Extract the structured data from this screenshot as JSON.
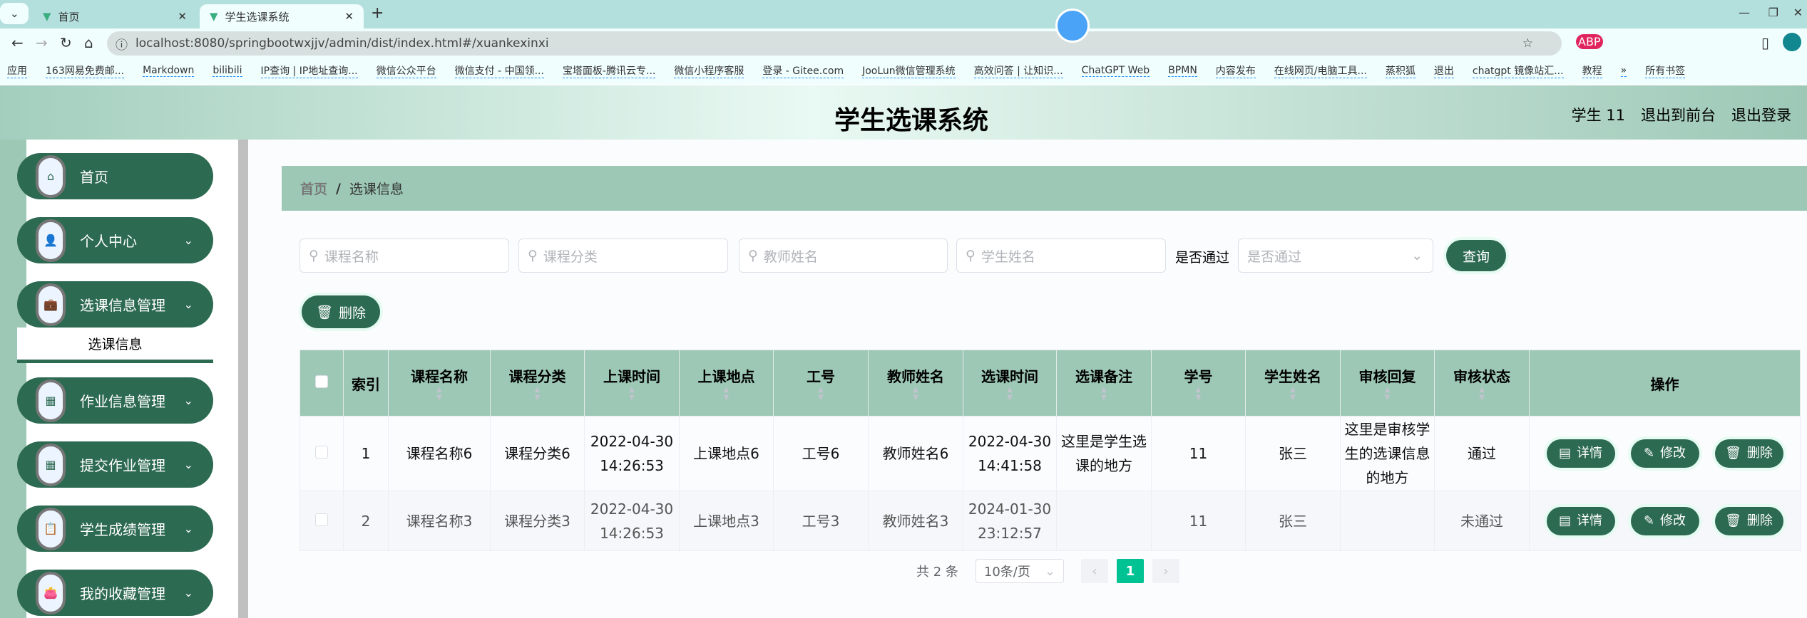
{
  "browser": {
    "tabs": [
      {
        "label": "首页"
      },
      {
        "label": "学生选课系统"
      }
    ],
    "url": "localhost:8080/springbootwxjjv/admin/dist/index.html#/xuankexinxi",
    "bookmarks": [
      "应用",
      "163网易免费邮...",
      "Markdown",
      "bilibili",
      "IP查询 | IP地址查询...",
      "微信公众平台",
      "微信支付 - 中国领...",
      "宝塔面板-腾讯云专...",
      "微信小程序客服",
      "登录 - Gitee.com",
      "JooLun微信管理系统",
      "高效问答 | 让知识...",
      "ChatGPT Web",
      "BPMN",
      "内容发布",
      "在线网页/电脑工具...",
      "蒸积狐",
      "退出",
      "chatgpt 镜像站汇...",
      "教程",
      "»",
      "所有书签"
    ]
  },
  "header": {
    "title": "学生选课系统",
    "user": "学生 11",
    "to_front": "退出到前台",
    "logout": "退出登录"
  },
  "sidebar": {
    "items": [
      {
        "label": "首页",
        "icon": "home-icon"
      },
      {
        "label": "个人中心",
        "icon": "user-icon"
      },
      {
        "label": "选课信息管理",
        "icon": "briefcase-icon"
      },
      {
        "label": "作业信息管理",
        "icon": "grid-icon"
      },
      {
        "label": "提交作业管理",
        "icon": "grid-icon"
      },
      {
        "label": "学生成绩管理",
        "icon": "clipboard-icon"
      },
      {
        "label": "我的收藏管理",
        "icon": "wallet-icon"
      }
    ],
    "active_sub": "选课信息"
  },
  "breadcrumb": {
    "home": "首页",
    "sep": "/",
    "current": "选课信息"
  },
  "search": {
    "course_name": "课程名称",
    "course_type": "课程分类",
    "teacher_name": "教师姓名",
    "student_name": "学生姓名",
    "pass_label": "是否通过",
    "pass_placeholder": "是否通过",
    "query": "查询"
  },
  "toolbar": {
    "delete": "删除"
  },
  "table": {
    "headers": [
      "索引",
      "课程名称",
      "课程分类",
      "上课时间",
      "上课地点",
      "工号",
      "教师姓名",
      "选课时间",
      "选课备注",
      "学号",
      "学生姓名",
      "审核回复",
      "审核状态",
      "操作"
    ],
    "rows": [
      [
        "1",
        "课程名称6",
        "课程分类6",
        "2022-04-30 14:26:53",
        "上课地点6",
        "工号6",
        "教师姓名6",
        "2022-04-30 14:41:58",
        "这里是学生选课的地方",
        "11",
        "张三",
        "这里是审核学生的选课信息的地方",
        "通过"
      ],
      [
        "2",
        "课程名称3",
        "课程分类3",
        "2022-04-30 14:26:53",
        "上课地点3",
        "工号3",
        "教师姓名3",
        "2024-01-30 23:12:57",
        "",
        "11",
        "张三",
        "",
        "未通过"
      ]
    ],
    "actions": {
      "detail": "详情",
      "edit": "修改",
      "delete": "删除"
    }
  },
  "pagination": {
    "total": "共 2 条",
    "page_size": "10条/页",
    "current_page": "1"
  },
  "colors": {
    "primary": "#2d6a52",
    "header": "#9dc8b6",
    "page_active": "#00c292"
  }
}
